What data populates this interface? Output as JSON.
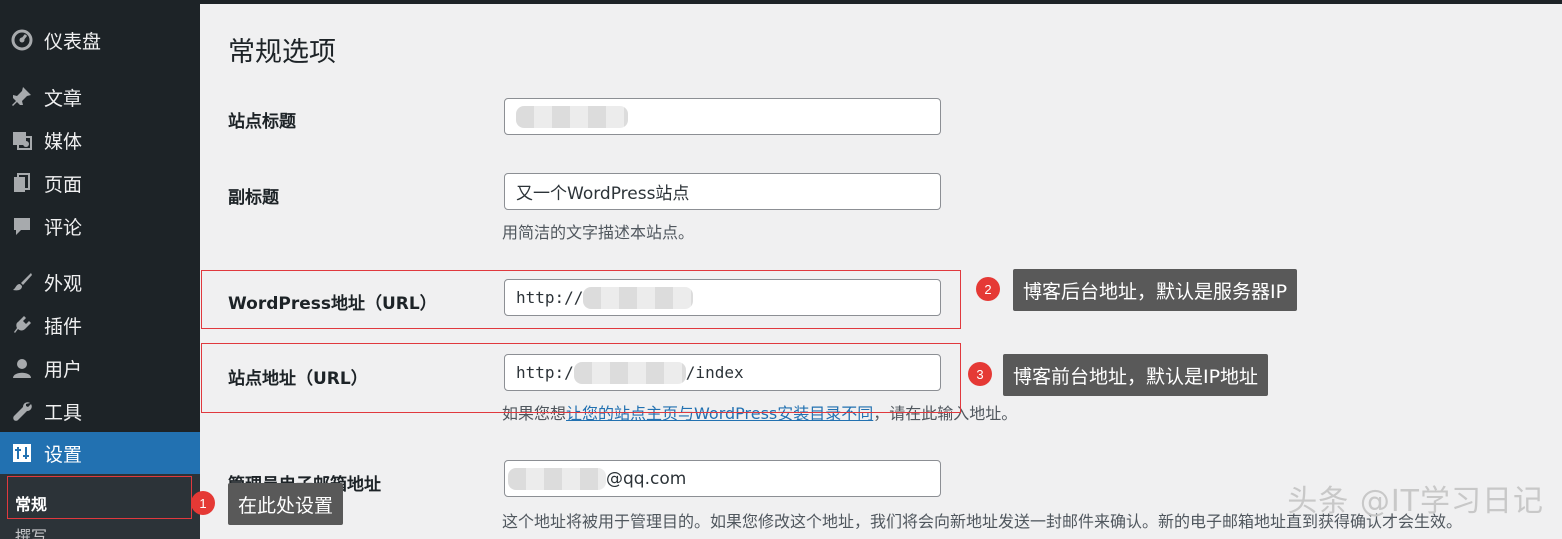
{
  "sidebar": {
    "items": [
      {
        "label": "仪表盘",
        "icon": "dashboard-icon"
      },
      {
        "label": "文章",
        "icon": "pin-icon"
      },
      {
        "label": "媒体",
        "icon": "media-icon"
      },
      {
        "label": "页面",
        "icon": "pages-icon"
      },
      {
        "label": "评论",
        "icon": "comment-icon"
      },
      {
        "label": "外观",
        "icon": "brush-icon"
      },
      {
        "label": "插件",
        "icon": "plugin-icon"
      },
      {
        "label": "用户",
        "icon": "user-icon"
      },
      {
        "label": "工具",
        "icon": "wrench-icon"
      },
      {
        "label": "设置",
        "icon": "settings-icon"
      }
    ],
    "submenu": [
      "常规",
      "撰写"
    ]
  },
  "page": {
    "title": "常规选项",
    "site_title_label": "站点标题",
    "tagline_label": "副标题",
    "tagline_value": "又一个WordPress站点",
    "tagline_desc": "用简洁的文字描述本站点。",
    "wp_url_label": "WordPress地址（URL）",
    "wp_url_prefix": "http://",
    "site_url_label": "站点地址（URL）",
    "site_url_prefix": "http:/",
    "site_url_suffix": "/index",
    "site_url_desc_pre": "如果您想",
    "site_url_desc_link": "让您的站点主页与WordPress安装目录不同",
    "site_url_desc_post": "，请在此输入地址。",
    "email_label": "管理员电子邮箱地址",
    "email_suffix": "@qq.com",
    "email_desc": "这个地址将被用于管理目的。如果您修改这个地址，我们将会向新地址发送一封邮件来确认。新的电子邮箱地址直到获得确认才会生效。"
  },
  "annotations": {
    "badge1": "1",
    "tip1": "在此处设置",
    "badge2": "2",
    "tip2": "博客后台地址，默认是服务器IP",
    "badge3": "3",
    "tip3": "博客前台地址，默认是IP地址"
  },
  "watermark": "头条 @IT学习日记",
  "colors": {
    "sidebar_bg": "#1d2327",
    "active_bg": "#2271b1",
    "annotation_red": "#e53935",
    "tooltip_bg": "#595959"
  }
}
